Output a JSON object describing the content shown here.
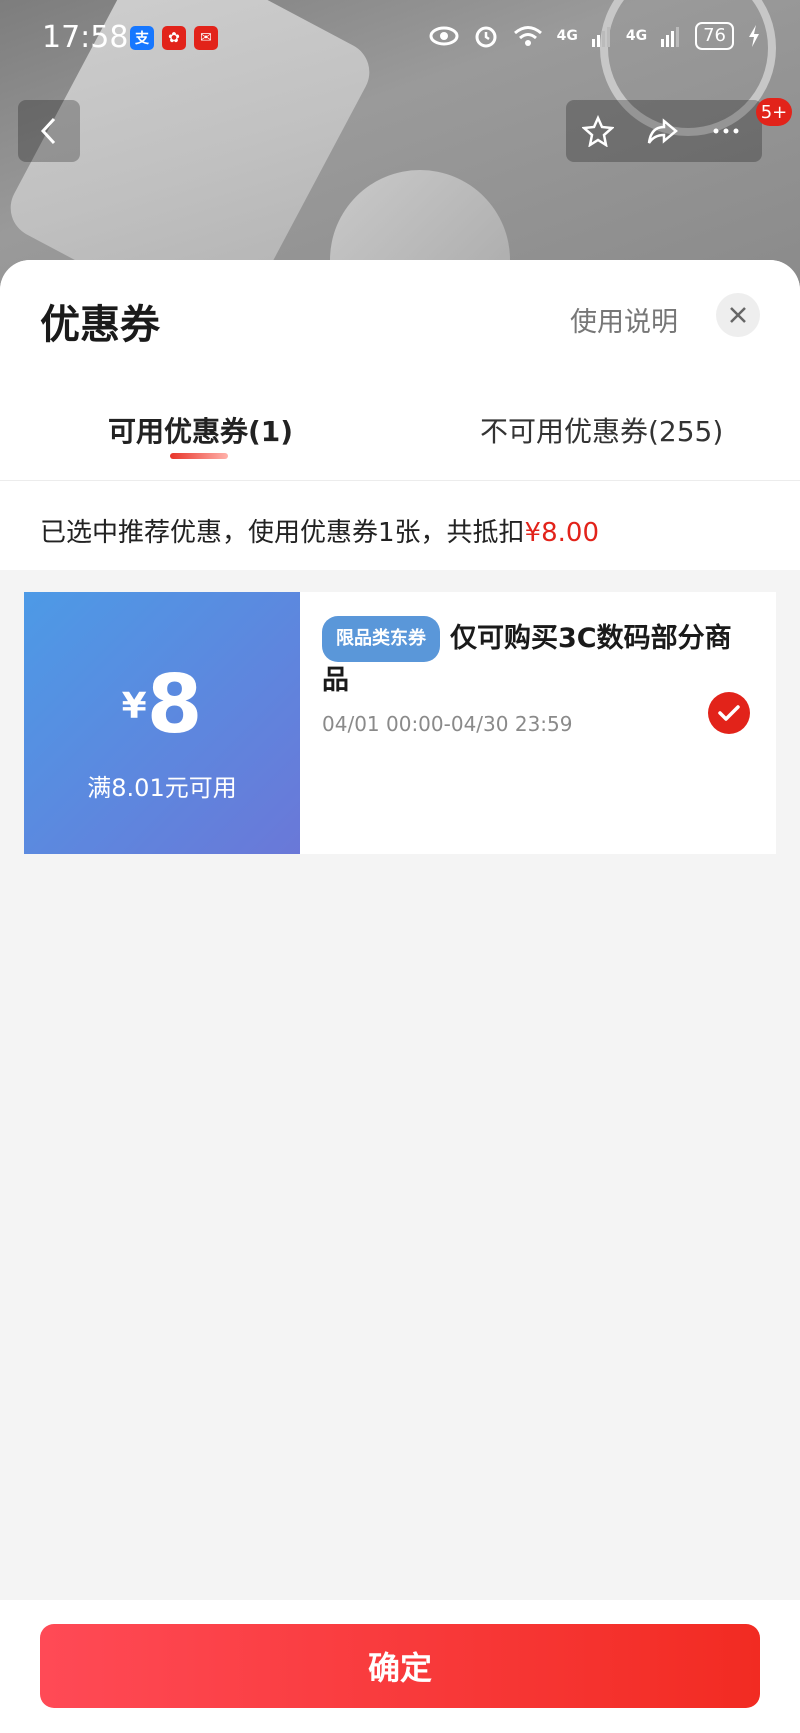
{
  "status_bar": {
    "time": "17:58",
    "network_1": "4G",
    "network_2": "4G",
    "battery": "76"
  },
  "nav": {
    "badge": "5+"
  },
  "sheet": {
    "title": "优惠券",
    "help_link": "使用说明",
    "tabs": [
      {
        "label": "可用优惠券(1)",
        "active": true
      },
      {
        "label": "不可用优惠券(255)",
        "active": false
      }
    ],
    "summary_prefix": "已选中推荐优惠，使用优惠券1张，共抵扣",
    "summary_amount": "¥8.00"
  },
  "coupon": {
    "currency": "¥",
    "amount": "8",
    "condition": "满8.01元可用",
    "tag": "限品类东券",
    "title": "仅可购买3C数码部分商品",
    "validity": "04/01 00:00-04/30 23:59",
    "selected": true
  },
  "footer": {
    "confirm_label": "确定"
  },
  "colors": {
    "accent": "#e2231a",
    "coupon_gradient_start": "#4d9ae6",
    "coupon_gradient_end": "#6a78d8",
    "tag": "#5a97d9"
  }
}
